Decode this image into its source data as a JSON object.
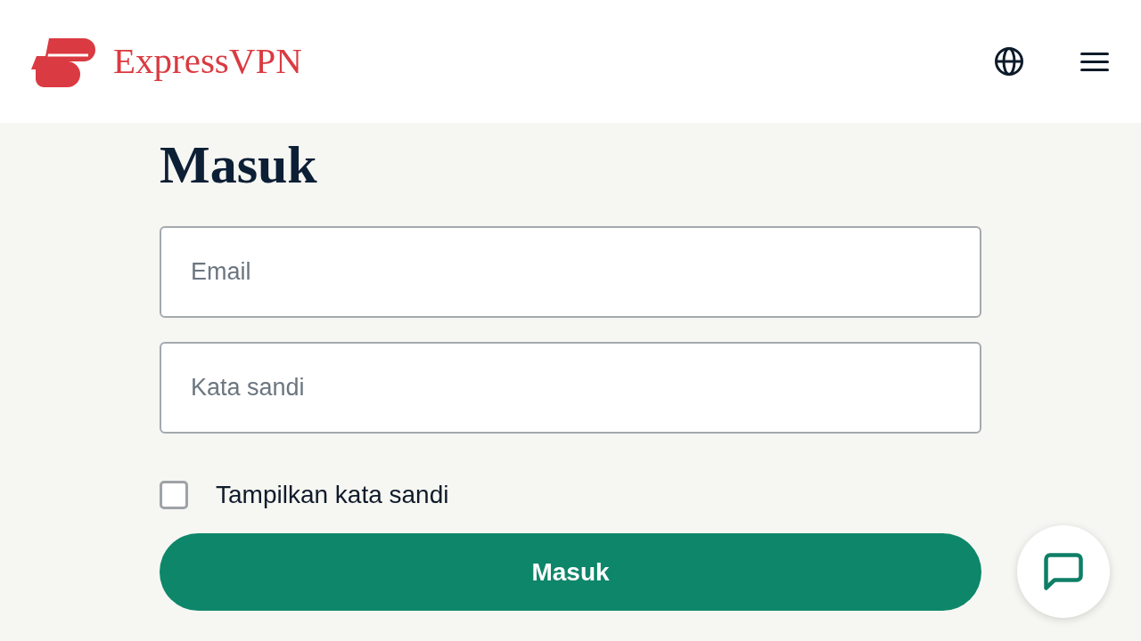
{
  "header": {
    "logo_text": "ExpressVPN"
  },
  "title": "Masuk",
  "fields": [
    {
      "placeholder": "Email"
    },
    {
      "placeholder": "Kata sandi"
    }
  ],
  "show_password": {
    "label": "Tampilkan kata sandi",
    "checked": false
  },
  "submit_button": {
    "label": "Masuk"
  }
}
